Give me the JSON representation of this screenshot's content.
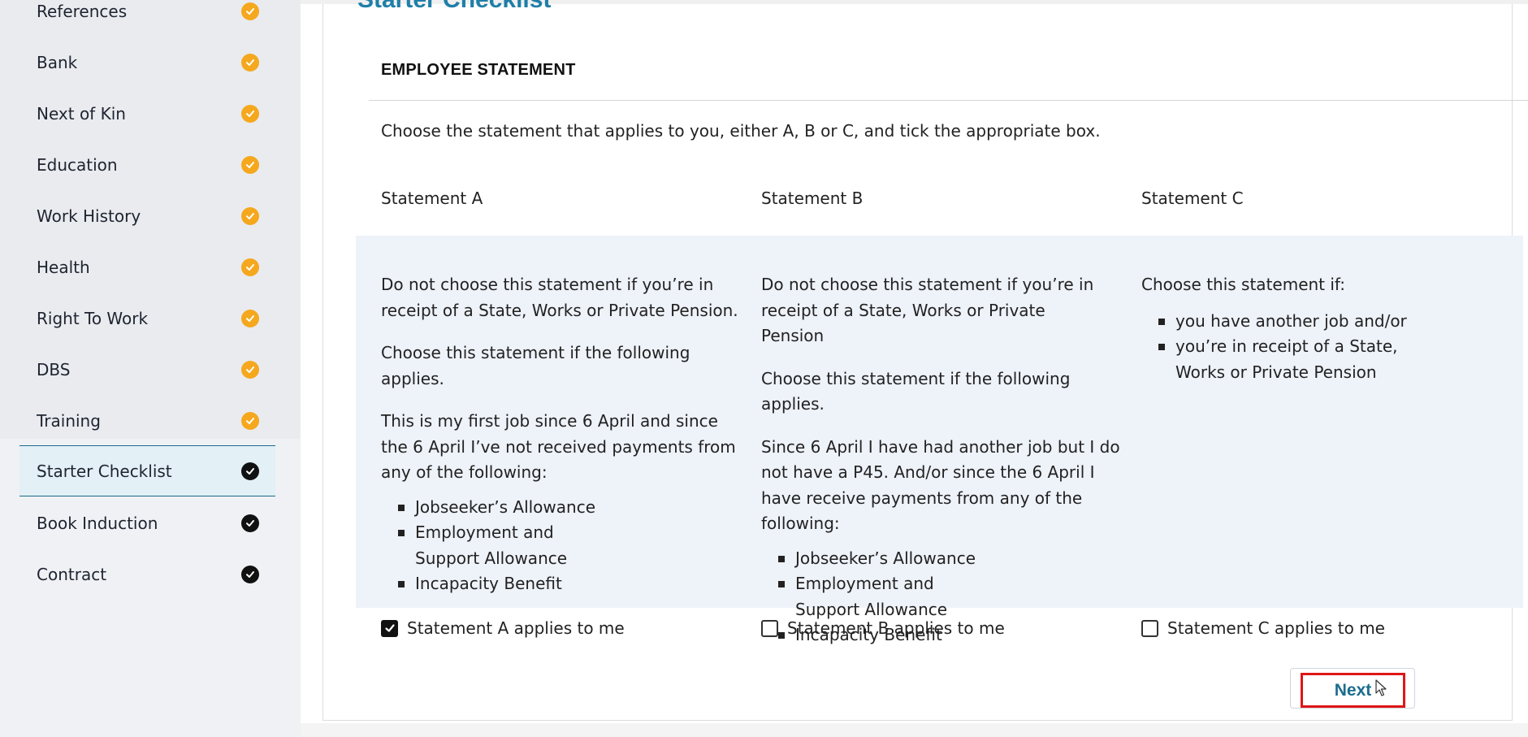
{
  "sidebar": {
    "items": [
      {
        "label": "References",
        "status": "done"
      },
      {
        "label": "Bank",
        "status": "done"
      },
      {
        "label": "Next of Kin",
        "status": "done"
      },
      {
        "label": "Education",
        "status": "done"
      },
      {
        "label": "Work History",
        "status": "done"
      },
      {
        "label": "Health",
        "status": "done"
      },
      {
        "label": "Right To Work",
        "status": "done"
      },
      {
        "label": "DBS",
        "status": "done"
      },
      {
        "label": "Training",
        "status": "done"
      },
      {
        "label": "Starter Checklist",
        "status": "current"
      },
      {
        "label": "Book Induction",
        "status": "pending"
      },
      {
        "label": "Contract",
        "status": "pending"
      }
    ],
    "colors": {
      "done": "#f5a81e",
      "pending": "#111111",
      "active_border": "#1d6b8a"
    }
  },
  "page": {
    "title": "Starter Checklist",
    "section_header": "EMPLOYEE STATEMENT",
    "intro": "Choose the statement that applies to you, either A, B or C, and tick the appropriate box."
  },
  "statements": [
    {
      "heading": "Statement A",
      "p1": "Do not choose this statement if you’re in receipt of a State, Works or Private Pension.",
      "p2": "Choose this statement if the following applies.",
      "p3": "This is my first job since 6 April and since the 6 April I’ve not received payments from any of the following:",
      "bullets": [
        "Jobseeker’s Allowance",
        "Employment and Support Allowance",
        "Incapacity Benefit"
      ],
      "checkbox_label": "Statement A applies to me",
      "checked": true
    },
    {
      "heading": "Statement B",
      "p1": "Do not choose this statement if you’re in receipt of a State, Works or Private Pension",
      "p2": "Choose this statement if the following applies.",
      "p3": "Since 6 April I have had another job but I do not have a P45. And/or since the 6 April I have receive payments from any of the following:",
      "bullets": [
        "Jobseeker’s Allowance",
        "Employment and Support Allowance",
        "Incapacity Benefit"
      ],
      "checkbox_label": "Statement B applies to me",
      "checked": false
    },
    {
      "heading": "Statement C",
      "p1": "Choose this statement if:",
      "bullets": [
        "you have another job and/or",
        "you’re in receipt of a State, Works or Private Pension"
      ],
      "checkbox_label": "Statement C applies to me",
      "checked": false
    }
  ],
  "actions": {
    "next_label": "Next",
    "highlight_color": "#e01616"
  }
}
